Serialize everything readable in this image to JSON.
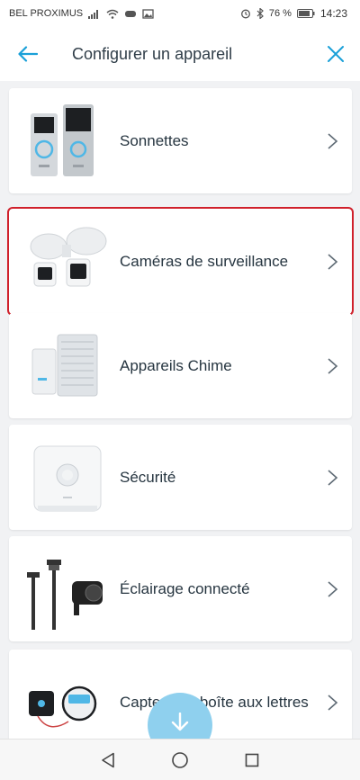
{
  "status_bar": {
    "carrier": "BEL PROXIMUS",
    "battery_percent": "76 %",
    "time": "14:23"
  },
  "header": {
    "title": "Configurer un appareil"
  },
  "colors": {
    "accent": "#1aa0d8",
    "selection_border": "#d0202b",
    "fab": "#8fd0ee"
  },
  "categories": [
    {
      "label": "Sonnettes",
      "icon": "doorbell-image",
      "selected": false
    },
    {
      "label": "Caméras de surveillance",
      "icon": "floodlight-camera-image",
      "selected": true
    },
    {
      "label": "Appareils Chime",
      "icon": "chime-image",
      "selected": false
    },
    {
      "label": "Sécurité",
      "icon": "alarm-base-station-image",
      "selected": false
    },
    {
      "label": "Éclairage connecté",
      "icon": "smart-lighting-image",
      "selected": false
    },
    {
      "label": "Capteur de boîte aux lettres",
      "icon": "mailbox-sensor-image",
      "selected": false
    }
  ],
  "nav_icons": [
    "back-triangle-icon",
    "home-circle-icon",
    "recents-square-icon"
  ]
}
